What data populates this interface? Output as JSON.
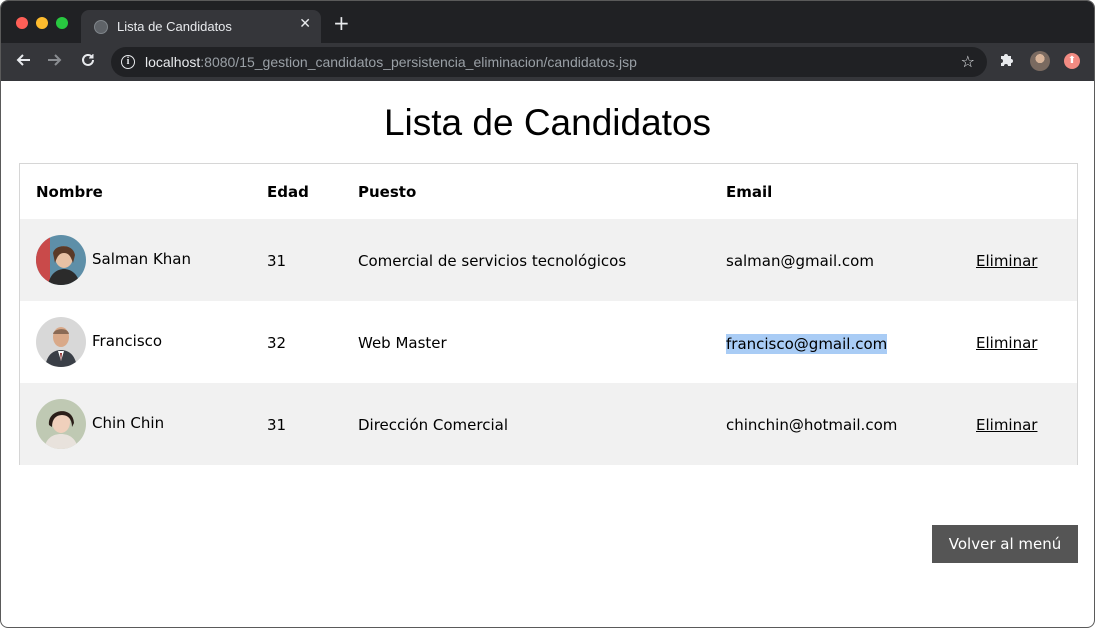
{
  "browser": {
    "tab_title": "Lista de Candidatos",
    "tab_close": "✕",
    "new_tab": "+",
    "url_host": "localhost",
    "url_path": ":8080/15_gestion_candidatos_persistencia_eliminacion/candidatos.jsp",
    "icons": [
      "back-arrow-icon",
      "forward-arrow-icon",
      "reload-icon",
      "info-icon",
      "star-icon",
      "puzzle-icon",
      "profile-avatar",
      "update-icon"
    ]
  },
  "page": {
    "title": "Lista de Candidatos",
    "headers": {
      "nombre": "Nombre",
      "edad": "Edad",
      "puesto": "Puesto",
      "email": "Email"
    },
    "rows": [
      {
        "nombre": "Salman Khan",
        "edad": "31",
        "puesto": "Comercial de servicios tecnológicos",
        "email": "salman@gmail.com",
        "accion": "Eliminar"
      },
      {
        "nombre": "Francisco",
        "edad": "32",
        "puesto": "Web Master",
        "email": "francisco@gmail.com",
        "accion": "Eliminar"
      },
      {
        "nombre": "Chin Chin",
        "edad": "31",
        "puesto": "Dirección Comercial",
        "email": "chinchin@hotmail.com",
        "accion": "Eliminar"
      }
    ],
    "back_button": "Volver al menú"
  },
  "colors": {
    "row_alt": "#f1f1f1",
    "button_bg": "#555555",
    "selection": "#a9ccf5"
  }
}
